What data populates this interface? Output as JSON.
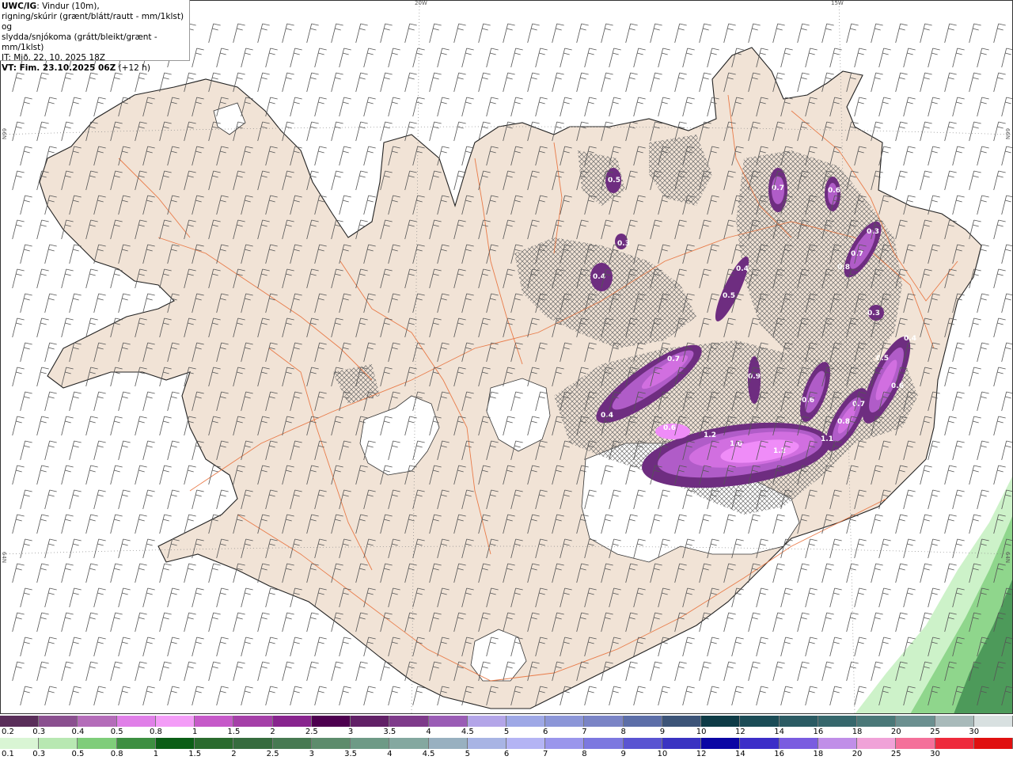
{
  "header": {
    "model": "UWC/IG",
    "title_rest": ": Vindur (10m),",
    "line2": "rigning/skúrir (grænt/blátt/rautt - mm/1klst) og",
    "line3": "slydda/snjókoma (grátt/bleikt/grænt - mm/1klst)",
    "it_label": "IT: Mið. 22. 10. 2025 18Z",
    "vt_label": "VT: Fim. 23.10.2025 06Z",
    "vt_offset": "(+12 h)"
  },
  "graticule": {
    "lon_20w": "20W",
    "lon_15w": "15W",
    "lat_66n_left": "66N",
    "lat_66n_right": "66N",
    "lat_64n_left": "64N",
    "lat_64n_right": "64N"
  },
  "map_colors": {
    "land": "#f1e3d6",
    "sea": "#ffffff",
    "coast": "#222222",
    "roads": "#e8703a",
    "glacier": "#ffffff",
    "snow_hatch": "#6b6b6b",
    "precip_light": "#b05cc8",
    "precip_mid": "#d16fe0",
    "precip_heavy": "#ef8cf8",
    "precip_dark": "#6e2d80",
    "rain_green_light": "#cdf2c9",
    "rain_green_mid": "#8fd68c",
    "rain_green_dark": "#4d9a5a"
  },
  "precip_labels": [
    "0.5",
    "0.7",
    "0.6",
    "0.3",
    "0.4",
    "0.3",
    "0.4",
    "0.7",
    "0.5",
    "0.8",
    "0.3",
    "0.7",
    "0.4",
    "0.5",
    "0.6",
    "0.6",
    "0.4",
    "0.9",
    "0.6",
    "1.2",
    "1.0",
    "1.2",
    "1.1",
    "0.8",
    "0.7"
  ],
  "colorbar_top": {
    "labels": [
      "0.2",
      "0.3",
      "0.4",
      "0.5",
      "0.8",
      "1",
      "1.5",
      "2",
      "2.5",
      "3",
      "3.5",
      "4",
      "4.5",
      "5",
      "6",
      "7",
      "8",
      "9",
      "10",
      "12",
      "14",
      "16",
      "18",
      "20",
      "25",
      "30"
    ],
    "colors": [
      "#5a2e5a",
      "#8a4f8f",
      "#b46cb9",
      "#e07fe8",
      "#f39cf7",
      "#c659c9",
      "#a53fa8",
      "#88248e",
      "#4d004f",
      "#612066",
      "#7e3a8a",
      "#9a5cb5",
      "#b3a5e8",
      "#9ea8e6",
      "#8c96d8",
      "#7a84c6",
      "#5c6ea8",
      "#3c5478",
      "#0e3b46",
      "#1b4c56",
      "#2b5b63",
      "#36676c",
      "#4a7878",
      "#6b9090",
      "#a8baba",
      "#d8e0e0"
    ]
  },
  "colorbar_bottom": {
    "labels": [
      "0.1",
      "0.3",
      "0.5",
      "0.8",
      "1",
      "1.5",
      "2",
      "2.5",
      "3",
      "3.5",
      "4",
      "4.5",
      "5",
      "6",
      "7",
      "8",
      "9",
      "10",
      "12",
      "14",
      "16",
      "18",
      "20",
      "25",
      "30"
    ],
    "colors": [
      "#d9f5d4",
      "#b8e8b2",
      "#7fcd7a",
      "#3d8f41",
      "#0b5e16",
      "#2a6b2e",
      "#366c3e",
      "#477a52",
      "#5d8c6c",
      "#6e9a86",
      "#84a8a0",
      "#98b0c0",
      "#a8b4e4",
      "#b4b4f4",
      "#9a96ec",
      "#7c78e0",
      "#5a54d2",
      "#3a33c2",
      "#0b06a4",
      "#3c2ec8",
      "#7a5ce0",
      "#c08ee8",
      "#f0a2d8",
      "#f4709a",
      "#ee2a3c",
      "#e01010"
    ]
  }
}
